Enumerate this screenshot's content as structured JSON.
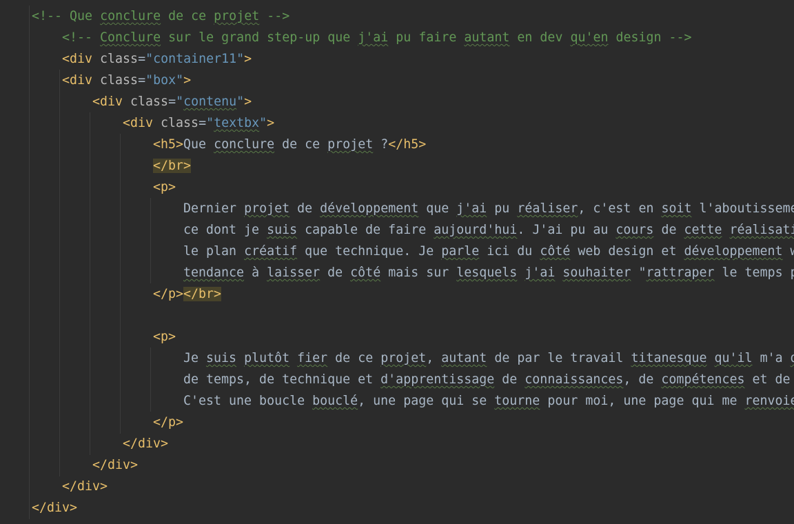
{
  "editor": {
    "language": "HTML",
    "colors": {
      "background": "#2b2b2b",
      "comment": "#629755",
      "tag": "#e8bf6a",
      "attribute": "#bababa",
      "attribute_value": "#6897bb",
      "text": "#a9b7c6",
      "highlight": "#48432a"
    }
  },
  "lines": [
    {
      "indent": 0,
      "tokens": [
        {
          "t": "<!-- Que ",
          "c": "comment"
        },
        {
          "t": "conclure",
          "c": "comment",
          "typo": true
        },
        {
          "t": " de ce ",
          "c": "comment"
        },
        {
          "t": "projet",
          "c": "comment",
          "typo": true
        },
        {
          "t": " -->",
          "c": "comment"
        }
      ]
    },
    {
      "indent": 1,
      "tokens": [
        {
          "t": "<!-- ",
          "c": "comment"
        },
        {
          "t": "Conclure",
          "c": "comment",
          "typo": true
        },
        {
          "t": " sur le grand step-up que ",
          "c": "comment"
        },
        {
          "t": "j'ai",
          "c": "comment",
          "typo": true
        },
        {
          "t": " pu faire ",
          "c": "comment"
        },
        {
          "t": "autant",
          "c": "comment",
          "typo": true
        },
        {
          "t": " en dev ",
          "c": "comment"
        },
        {
          "t": "qu'en",
          "c": "comment",
          "typo": true
        },
        {
          "t": " design -->",
          "c": "comment"
        }
      ]
    },
    {
      "indent": 1,
      "tokens": [
        {
          "t": "<div ",
          "c": "tag"
        },
        {
          "t": "class",
          "c": "attr"
        },
        {
          "t": "=",
          "c": "eq"
        },
        {
          "t": "\"container11\"",
          "c": "val-blue"
        },
        {
          "t": ">",
          "c": "tag"
        }
      ]
    },
    {
      "indent": 1,
      "tokens": [
        {
          "t": "<div ",
          "c": "tag"
        },
        {
          "t": "class",
          "c": "attr"
        },
        {
          "t": "=",
          "c": "eq"
        },
        {
          "t": "\"box\"",
          "c": "val-blue"
        },
        {
          "t": ">",
          "c": "tag"
        }
      ]
    },
    {
      "indent": 2,
      "tokens": [
        {
          "t": "<div ",
          "c": "tag"
        },
        {
          "t": "class",
          "c": "attr"
        },
        {
          "t": "=",
          "c": "eq"
        },
        {
          "t": "\"",
          "c": "val-blue"
        },
        {
          "t": "contenu",
          "c": "val-blue",
          "typo": true
        },
        {
          "t": "\"",
          "c": "val-blue"
        },
        {
          "t": ">",
          "c": "tag"
        }
      ]
    },
    {
      "indent": 3,
      "tokens": [
        {
          "t": "<div ",
          "c": "tag"
        },
        {
          "t": "class",
          "c": "attr"
        },
        {
          "t": "=",
          "c": "eq"
        },
        {
          "t": "\"",
          "c": "val-blue"
        },
        {
          "t": "textbx",
          "c": "val-blue",
          "typo": true
        },
        {
          "t": "\"",
          "c": "val-blue"
        },
        {
          "t": ">",
          "c": "tag"
        }
      ]
    },
    {
      "indent": 4,
      "tokens": [
        {
          "t": "<h5>",
          "c": "tag"
        },
        {
          "t": "Que ",
          "c": "text"
        },
        {
          "t": "conclure",
          "c": "text",
          "typo": true
        },
        {
          "t": " de ce ",
          "c": "text"
        },
        {
          "t": "projet",
          "c": "text",
          "typo": true
        },
        {
          "t": " ?",
          "c": "text"
        },
        {
          "t": "</h5>",
          "c": "tag"
        }
      ]
    },
    {
      "indent": 4,
      "tokens": [
        {
          "t": "</br>",
          "c": "tag",
          "hl": true
        }
      ]
    },
    {
      "indent": 4,
      "tokens": [
        {
          "t": "<p>",
          "c": "tag"
        }
      ]
    },
    {
      "indent": 5,
      "tokens": [
        {
          "t": "Dernier ",
          "c": "text"
        },
        {
          "t": "projet",
          "c": "text",
          "typo": true
        },
        {
          "t": " de ",
          "c": "text"
        },
        {
          "t": "développement",
          "c": "text",
          "typo": true
        },
        {
          "t": " que ",
          "c": "text"
        },
        {
          "t": "j'ai",
          "c": "text",
          "typo": true
        },
        {
          "t": " pu ",
          "c": "text"
        },
        {
          "t": "réaliser",
          "c": "text",
          "typo": true
        },
        {
          "t": ", c'est en ",
          "c": "text"
        },
        {
          "t": "soit",
          "c": "text",
          "typo": true
        },
        {
          "t": " l'aboutisseme",
          "c": "text"
        }
      ]
    },
    {
      "indent": 5,
      "tokens": [
        {
          "t": "ce dont je ",
          "c": "text"
        },
        {
          "t": "suis",
          "c": "text",
          "typo": true
        },
        {
          "t": " capable de faire ",
          "c": "text"
        },
        {
          "t": "aujourd'hui",
          "c": "text",
          "typo": true
        },
        {
          "t": ". J'ai pu au ",
          "c": "text"
        },
        {
          "t": "cours",
          "c": "text",
          "typo": true
        },
        {
          "t": " de ",
          "c": "text"
        },
        {
          "t": "cette",
          "c": "text",
          "typo": true
        },
        {
          "t": " ",
          "c": "text"
        },
        {
          "t": "réalisati",
          "c": "text",
          "typo": true
        }
      ]
    },
    {
      "indent": 5,
      "tokens": [
        {
          "t": "le plan ",
          "c": "text"
        },
        {
          "t": "créatif",
          "c": "text",
          "typo": true
        },
        {
          "t": " que technique. Je ",
          "c": "text"
        },
        {
          "t": "parle",
          "c": "text",
          "typo": true
        },
        {
          "t": " ici du ",
          "c": "text"
        },
        {
          "t": "côté",
          "c": "text",
          "typo": true
        },
        {
          "t": " web design et ",
          "c": "text"
        },
        {
          "t": "développement",
          "c": "text",
          "typo": true
        },
        {
          "t": " w",
          "c": "text"
        }
      ]
    },
    {
      "indent": 5,
      "tokens": [
        {
          "t": "tendance",
          "c": "text",
          "typo": true
        },
        {
          "t": " à ",
          "c": "text"
        },
        {
          "t": "laisser",
          "c": "text",
          "typo": true
        },
        {
          "t": " de ",
          "c": "text"
        },
        {
          "t": "côté",
          "c": "text",
          "typo": true
        },
        {
          "t": " mais sur ",
          "c": "text"
        },
        {
          "t": "lesquels",
          "c": "text",
          "typo": true
        },
        {
          "t": " ",
          "c": "text"
        },
        {
          "t": "j'ai",
          "c": "text",
          "typo": true
        },
        {
          "t": " ",
          "c": "text"
        },
        {
          "t": "souhaiter",
          "c": "text",
          "typo": true
        },
        {
          "t": " \"",
          "c": "text"
        },
        {
          "t": "rattraper",
          "c": "text",
          "typo": true
        },
        {
          "t": " le temps p",
          "c": "text"
        }
      ]
    },
    {
      "indent": 4,
      "tokens": [
        {
          "t": "</p>",
          "c": "tag"
        },
        {
          "t": "</br>",
          "c": "tag",
          "hl": true
        }
      ]
    },
    {
      "indent": 0,
      "tokens": []
    },
    {
      "indent": 4,
      "tokens": [
        {
          "t": "<p>",
          "c": "tag"
        }
      ]
    },
    {
      "indent": 5,
      "tokens": [
        {
          "t": "Je ",
          "c": "text"
        },
        {
          "t": "suis",
          "c": "text",
          "typo": true
        },
        {
          "t": " ",
          "c": "text"
        },
        {
          "t": "plutôt",
          "c": "text",
          "typo": true
        },
        {
          "t": " ",
          "c": "text"
        },
        {
          "t": "fier",
          "c": "text",
          "typo": true
        },
        {
          "t": " de ce ",
          "c": "text"
        },
        {
          "t": "projet",
          "c": "text",
          "typo": true
        },
        {
          "t": ", ",
          "c": "text"
        },
        {
          "t": "autant",
          "c": "text",
          "typo": true
        },
        {
          "t": " de par le travail ",
          "c": "text"
        },
        {
          "t": "titanesque",
          "c": "text",
          "typo": true
        },
        {
          "t": " ",
          "c": "text"
        },
        {
          "t": "qu'il",
          "c": "text",
          "typo": true
        },
        {
          "t": " m'a ",
          "c": "text"
        },
        {
          "t": "d",
          "c": "text",
          "typo": true
        }
      ]
    },
    {
      "indent": 5,
      "tokens": [
        {
          "t": "de temps, de technique et ",
          "c": "text"
        },
        {
          "t": "d'apprentissage",
          "c": "text",
          "typo": true
        },
        {
          "t": " de ",
          "c": "text"
        },
        {
          "t": "connaissances",
          "c": "text",
          "typo": true
        },
        {
          "t": ", de ",
          "c": "text"
        },
        {
          "t": "compétences",
          "c": "text",
          "typo": true
        },
        {
          "t": " et de ",
          "c": "text"
        }
      ]
    },
    {
      "indent": 5,
      "tokens": [
        {
          "t": "C'est une boucle ",
          "c": "text"
        },
        {
          "t": "bouclé",
          "c": "text",
          "typo": true
        },
        {
          "t": ", une page qui se ",
          "c": "text"
        },
        {
          "t": "tourne",
          "c": "text",
          "typo": true
        },
        {
          "t": " pour moi, une page qui me ",
          "c": "text"
        },
        {
          "t": "renvoie",
          "c": "text",
          "typo": true
        }
      ]
    },
    {
      "indent": 4,
      "tokens": [
        {
          "t": "</p>",
          "c": "tag"
        }
      ]
    },
    {
      "indent": 3,
      "tokens": [
        {
          "t": "</div>",
          "c": "tag"
        }
      ]
    },
    {
      "indent": 2,
      "tokens": [
        {
          "t": "</div>",
          "c": "tag"
        }
      ]
    },
    {
      "indent": 1,
      "tokens": [
        {
          "t": "</div>",
          "c": "tag"
        }
      ]
    },
    {
      "indent": 0,
      "tokens": [
        {
          "t": "</div>",
          "c": "tag"
        }
      ]
    }
  ]
}
